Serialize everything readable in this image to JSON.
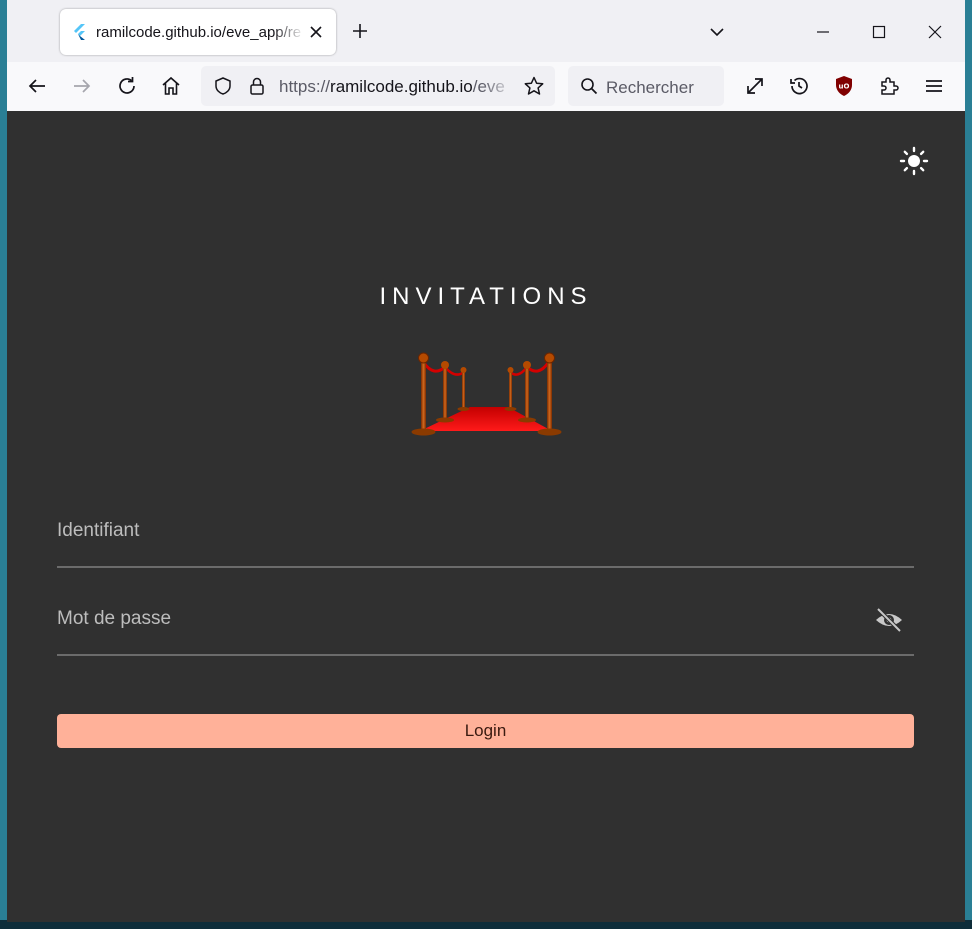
{
  "browser": {
    "tab": {
      "title": "ramilcode.github.io/eve_app/re",
      "favicon": "flutter-icon"
    },
    "address_bar": {
      "scheme": "https://",
      "host": "ramilcode.github.io",
      "path": "/eve"
    },
    "search": {
      "placeholder": "Rechercher"
    },
    "icons": {
      "back": "arrow-left-icon",
      "forward": "arrow-right-icon",
      "reload": "reload-icon",
      "home": "home-icon",
      "shield": "shield-icon",
      "lock": "lock-icon",
      "bookmark": "star-icon",
      "fullscreen": "expand-icon",
      "history": "history-icon",
      "ublock": "ublock-icon",
      "extensions": "puzzle-icon",
      "menu": "hamburger-icon"
    }
  },
  "app": {
    "title": "INVITATIONS",
    "logo": "red-carpet-logo",
    "theme_toggle": "sun-icon",
    "form": {
      "username_label": "Identifiant",
      "password_label": "Mot de passe",
      "password_visibility_icon": "eye-off-icon",
      "login_label": "Login"
    }
  },
  "colors": {
    "background": "#303030",
    "accent": "#ffb199",
    "text": "#ffffff",
    "field_label": "#bdbdbd"
  }
}
